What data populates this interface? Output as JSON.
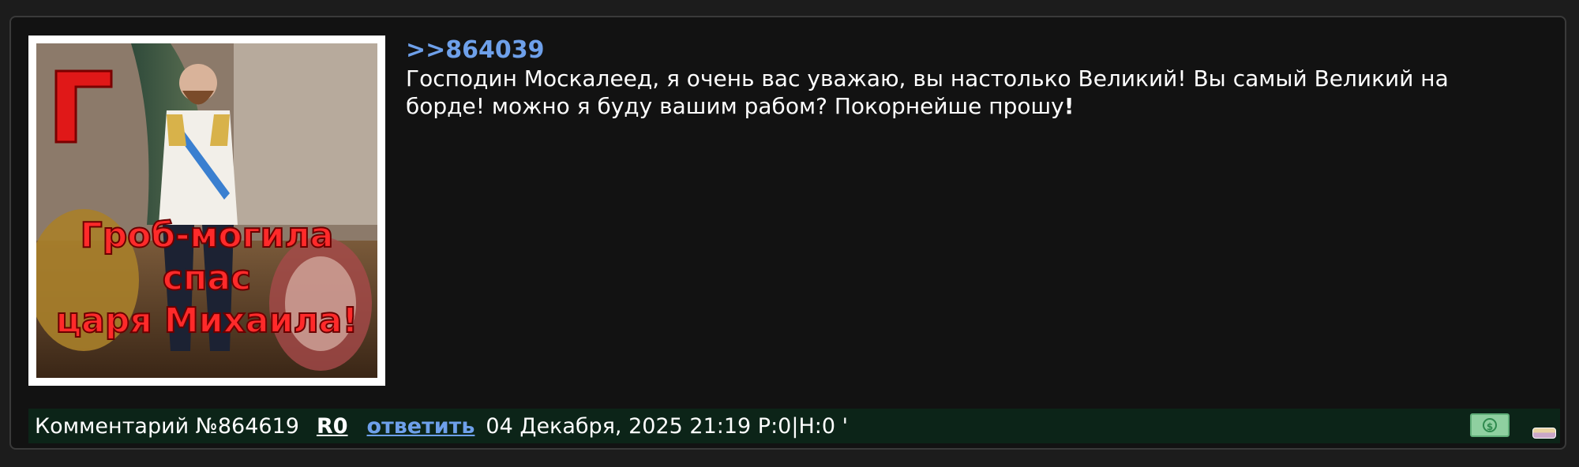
{
  "post": {
    "reply_ref": ">>864039",
    "message_main": "Господин Москалеед, я очень вас уважаю, вы настолько Великий! Вы самый Великий на борде! можно я буду вашим рабом? Покорнейше прошу",
    "message_end": "!",
    "image": {
      "corner_letter": "Г",
      "caption_line1": "Гроб-могила",
      "caption_line2": "спас",
      "caption_line3": "царя Михаила!"
    }
  },
  "footer": {
    "comment_label": "Комментарий №864619",
    "r0_label": "R0",
    "reply_label": "ответить",
    "date_text": "04 Декабря, 2025 21:19 Р:0|Н:0 '"
  },
  "icons": {
    "money": "money-icon",
    "eraser": "eraser-icon"
  },
  "colors": {
    "link": "#6ea0ea",
    "footer_bg": "#0c2418",
    "post_bg": "#121212"
  }
}
